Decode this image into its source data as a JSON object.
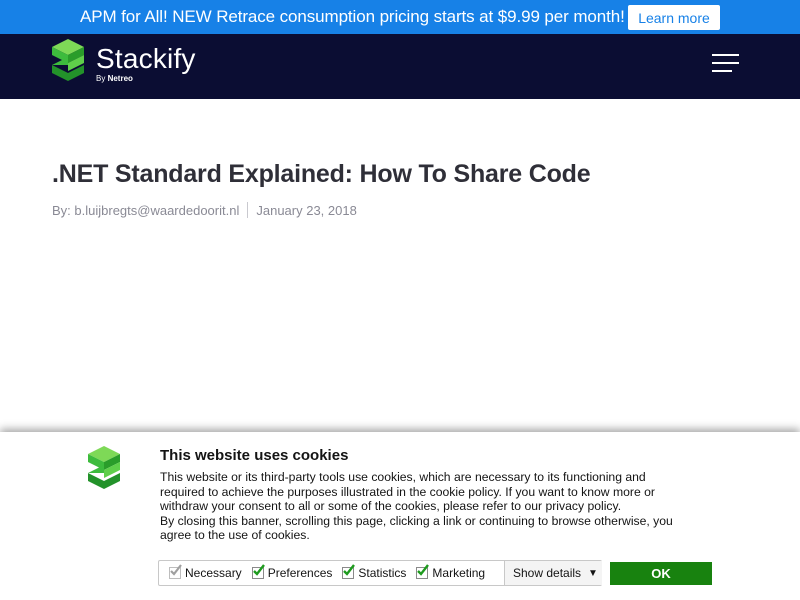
{
  "promo": {
    "text": "APM for All! NEW Retrace consumption pricing starts at $9.99 per month!",
    "button_label": "Learn more"
  },
  "header": {
    "logo_word": "Stackify",
    "logo_by": "By",
    "logo_brand": "Netreo",
    "menu_icon": "hamburger-menu-icon"
  },
  "article": {
    "title": ".NET Standard Explained: How To Share Code",
    "author": "By: b.luijbregts@waardedoorit.nl",
    "date": "January 23, 2018"
  },
  "cookie_banner": {
    "title": "This website uses cookies",
    "body_lines": [
      "This website or its third-party tools use cookies, which are necessary to its functioning and",
      "required to achieve the purposes illustrated in the cookie policy. If you want to know more or",
      "withdraw your consent to all or some of the cookies, please refer to our privacy policy.",
      "By closing this banner, scrolling this page, clicking a link or continuing to browse otherwise, you",
      "agree to the use of cookies."
    ],
    "options": [
      {
        "label": "Necessary",
        "checked": true,
        "disabled": true
      },
      {
        "label": "Preferences",
        "checked": true,
        "disabled": false
      },
      {
        "label": "Statistics",
        "checked": true,
        "disabled": false
      },
      {
        "label": "Marketing",
        "checked": true,
        "disabled": false
      }
    ],
    "details_label": "Show details",
    "ok_label": "OK"
  },
  "colors": {
    "promo_bg": "#1781e7",
    "header_bg": "#0b0d33",
    "logo_green": "#3dbb3d",
    "ok_green": "#18820f"
  }
}
